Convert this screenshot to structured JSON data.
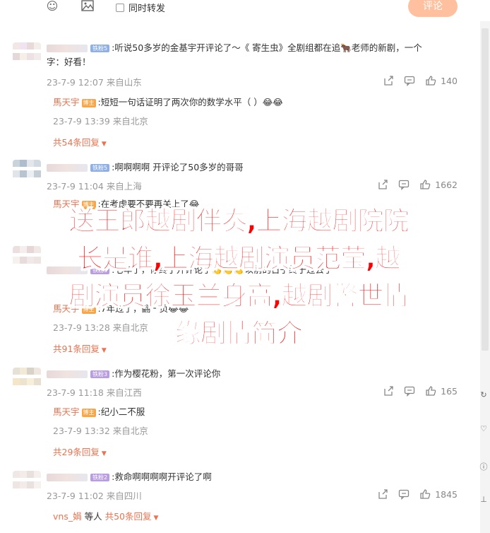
{
  "toolbar": {
    "emoji_icon": "smiley-icon",
    "image_icon": "image-icon",
    "repost_label": "同时转发",
    "comment_button": "评论"
  },
  "comments": [
    {
      "badge": "铁粉5",
      "text": ":听说50多岁的金基宇开评论了～《 寄生虫》全剧组都在追🐂老师的新剧，一个",
      "text2": "字：好看！",
      "meta": "23-7-9 12:07 来自山东",
      "likes": "140",
      "replies": [
        {
          "name": "馬天宇",
          "text": ":短短一句话证明了两次你的数学水平（      ）😂😂",
          "meta": "23-7-9 13:39 来自北京"
        }
      ],
      "more": "共54条回复"
    },
    {
      "badge": "铁粉5",
      "text": ":啊啊啊啊 开评论了50多岁的哥哥",
      "meta": "23-7-9 11:04 来自上海",
      "likes": "1662",
      "replies": [
        {
          "name": "馬天宇",
          "text": ":在考虑要不要再关上了😂",
          "meta": ""
        }
      ],
      "more": ""
    },
    {
      "badge": "铁粉5",
      "text": ":七年了，你终于开评论了👏👏👏以前的日子终于过去了",
      "meta": "",
      "likes": "",
      "replies": [
        {
          "name": "馬天宇",
          "text": ":7年过了，翻一页😂😂",
          "meta": "23-7-9 13:28 来自北京"
        }
      ],
      "more": "共91条回复"
    },
    {
      "badge": "铁粉3",
      "text": ":作为樱花粉，第一次评论你",
      "meta": "23-7-9 11:18 来自江西",
      "likes": "165",
      "replies": [
        {
          "name": "馬天宇",
          "text": ":纪小二不服",
          "meta": "23-7-9 13:32 来自北京"
        }
      ],
      "more": "共29条回复"
    },
    {
      "badge": "铁粉2",
      "text": ":救命啊啊啊啊开评论了啊",
      "meta": "23-7-9 11:02 来自四川",
      "likes": "1845",
      "replies": [],
      "more_prefix": "vns_娟",
      "more_mid": "等人",
      "more": "共50条回复"
    }
  ],
  "overlay_title": {
    "line1": "送王郎越剧伴奏,上海越剧院院",
    "line2": "长是谁,上海越剧演员范莹,越",
    "line3": "剧演员徐玉兰身高,越剧警世情",
    "line4": "缘剧情简介"
  },
  "colors": {
    "accent": "#eb7350",
    "comment_btn": "#ffc09f",
    "overlay_text": "#ff0000"
  }
}
